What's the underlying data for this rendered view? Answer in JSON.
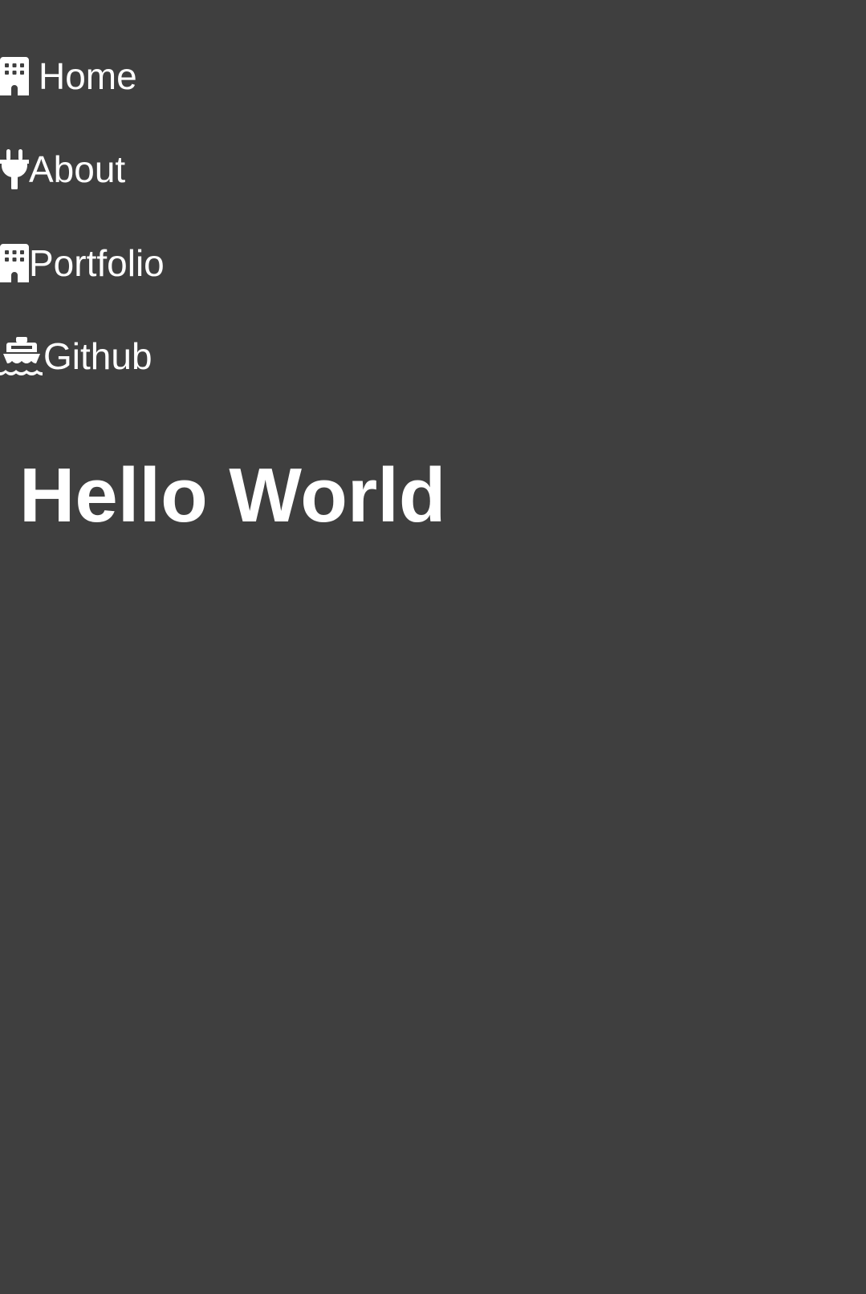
{
  "nav": {
    "items": [
      {
        "id": "home",
        "label": "Home",
        "icon": "building-icon"
      },
      {
        "id": "about",
        "label": "About",
        "icon": "plug-icon"
      },
      {
        "id": "portfolio",
        "label": "Portfolio",
        "icon": "building-icon"
      },
      {
        "id": "github",
        "label": "Github",
        "icon": "ship-icon"
      }
    ]
  },
  "main": {
    "title": "Hello World"
  },
  "colors": {
    "background": "#3f3f3f",
    "text": "#ffffff"
  }
}
